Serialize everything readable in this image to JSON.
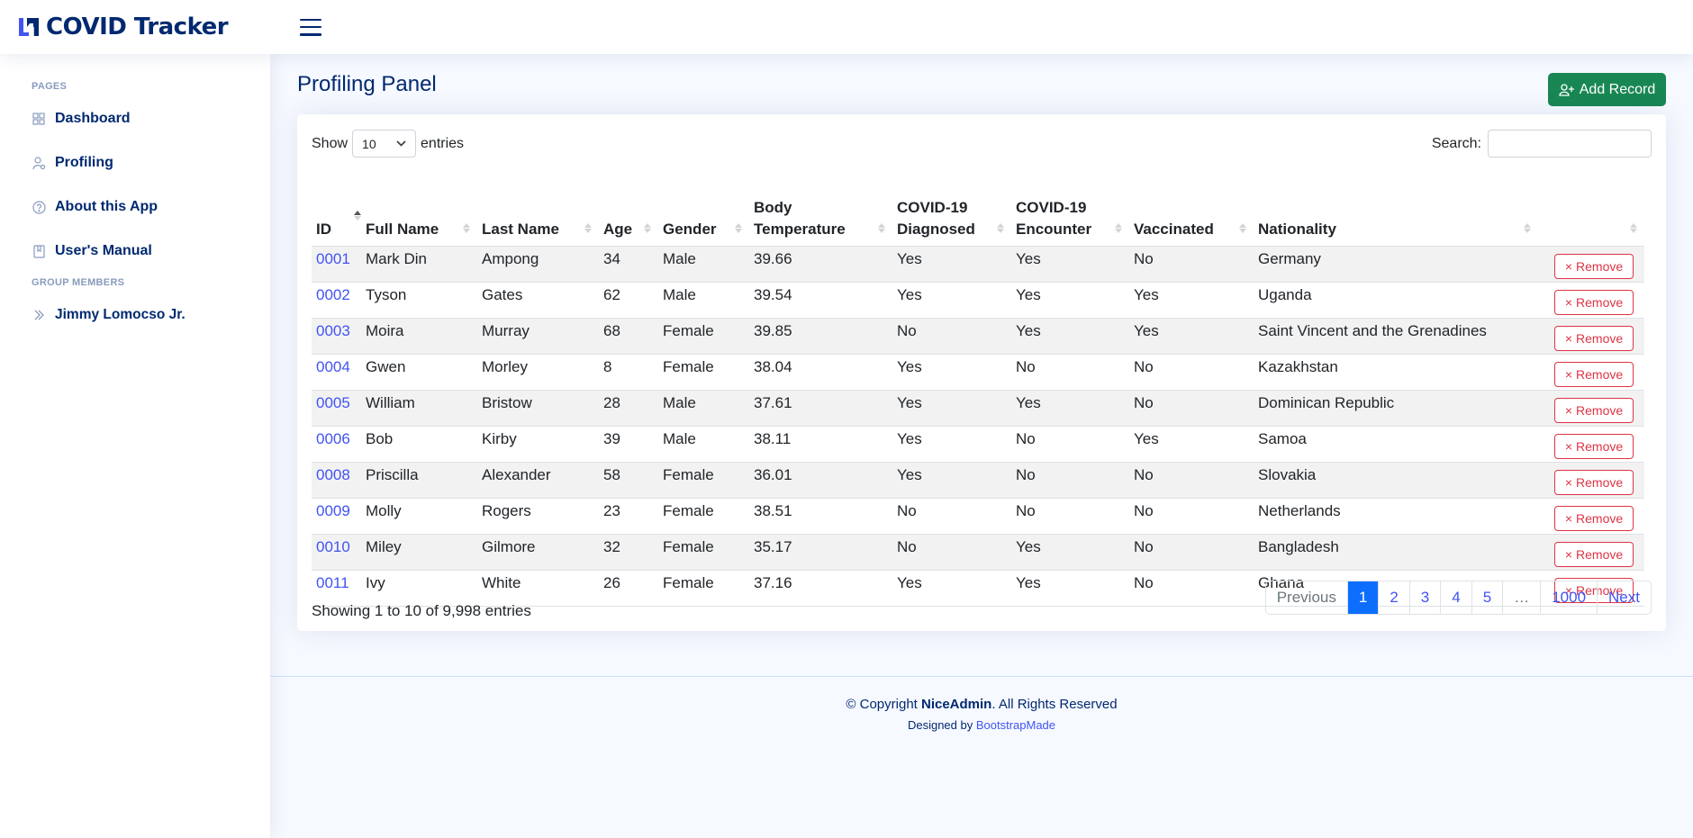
{
  "header": {
    "app_title": "COVID Tracker"
  },
  "sidebar": {
    "pages_heading": "PAGES",
    "items": [
      {
        "label": "Dashboard",
        "icon": "grid-icon"
      },
      {
        "label": "Profiling",
        "icon": "person-gear-icon"
      },
      {
        "label": "About this App",
        "icon": "question-circle-icon"
      },
      {
        "label": "User's Manual",
        "icon": "journal-bookmark-icon"
      }
    ],
    "group_heading": "GROUP MEMBERS",
    "members": [
      {
        "label": "Jimmy Lomocso Jr.",
        "icon": "chevron-double-right-icon"
      }
    ]
  },
  "main": {
    "page_title": "Profiling Panel",
    "add_button_label": "Add Record"
  },
  "table_controls": {
    "show_label": "Show",
    "entries_label": "entries",
    "page_size": "10",
    "search_label": "Search:",
    "search_value": ""
  },
  "table": {
    "columns": [
      "ID",
      "Full Name",
      "Last Name",
      "Age",
      "Gender",
      "Body Temperature",
      "COVID-19 Diagnosed",
      "COVID-19 Encounter",
      "Vaccinated",
      "Nationality",
      ""
    ],
    "remove_label": "Remove",
    "rows": [
      [
        "0001",
        "Mark Din",
        "Ampong",
        "34",
        "Male",
        "39.66",
        "Yes",
        "Yes",
        "No",
        "Germany"
      ],
      [
        "0002",
        "Tyson",
        "Gates",
        "62",
        "Male",
        "39.54",
        "Yes",
        "Yes",
        "Yes",
        "Uganda"
      ],
      [
        "0003",
        "Moira",
        "Murray",
        "68",
        "Female",
        "39.85",
        "No",
        "Yes",
        "Yes",
        "Saint Vincent and the Grenadines"
      ],
      [
        "0004",
        "Gwen",
        "Morley",
        "8",
        "Female",
        "38.04",
        "Yes",
        "No",
        "No",
        "Kazakhstan"
      ],
      [
        "0005",
        "William",
        "Bristow",
        "28",
        "Male",
        "37.61",
        "Yes",
        "Yes",
        "No",
        "Dominican Republic"
      ],
      [
        "0006",
        "Bob",
        "Kirby",
        "39",
        "Male",
        "38.11",
        "Yes",
        "No",
        "Yes",
        "Samoa"
      ],
      [
        "0008",
        "Priscilla",
        "Alexander",
        "58",
        "Female",
        "36.01",
        "Yes",
        "No",
        "No",
        "Slovakia"
      ],
      [
        "0009",
        "Molly",
        "Rogers",
        "23",
        "Female",
        "38.51",
        "No",
        "No",
        "No",
        "Netherlands"
      ],
      [
        "0010",
        "Miley",
        "Gilmore",
        "32",
        "Female",
        "35.17",
        "No",
        "Yes",
        "No",
        "Bangladesh"
      ],
      [
        "0011",
        "Ivy",
        "White",
        "26",
        "Female",
        "37.16",
        "Yes",
        "Yes",
        "No",
        "Ghana"
      ]
    ]
  },
  "footer_info": {
    "showing_text": "Showing 1 to 10 of 9,998 entries"
  },
  "pagination": {
    "previous": "Previous",
    "pages": [
      "1",
      "2",
      "3",
      "4",
      "5",
      "…",
      "1000"
    ],
    "active_page": "1",
    "next": "Next"
  },
  "footer": {
    "copyright_prefix": "© Copyright",
    "brand": "NiceAdmin",
    "copyright_suffix": ". All Rights Reserved",
    "designed_by": "Designed by",
    "designer_link": "BootstrapMade"
  },
  "colors": {
    "brand_navy": "#012970",
    "link_blue": "#4154f1",
    "success_green": "#198754",
    "danger_red": "#dc3545",
    "active_page_blue": "#0d6efd"
  }
}
